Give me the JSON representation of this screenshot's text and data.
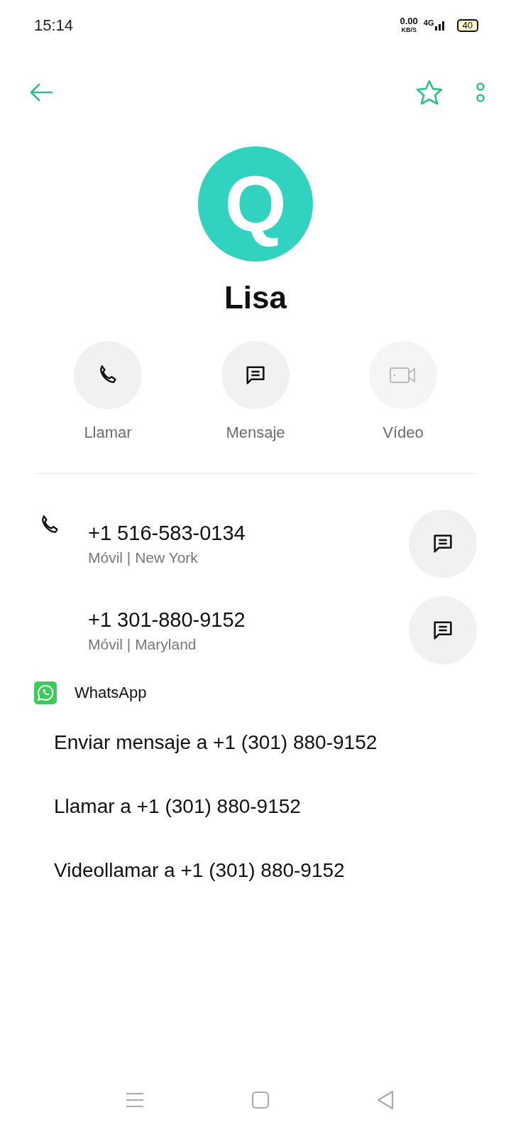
{
  "status_bar": {
    "time": "15:14",
    "speed": "0.00",
    "speed_unit": "KB/S",
    "network": "4G",
    "battery": "40"
  },
  "contact": {
    "name": "Lisa",
    "initial": "Q",
    "favorite": false
  },
  "actions": [
    {
      "kind": "call",
      "label": "Llamar",
      "disabled": false
    },
    {
      "kind": "message",
      "label": "Mensaje",
      "disabled": false
    },
    {
      "kind": "video",
      "label": "Vídeo",
      "disabled": true
    }
  ],
  "phones": [
    {
      "number": "+1 516-583-0134",
      "detail": "Móvil | New York",
      "show_icon": true
    },
    {
      "number": "+1 301-880-9152",
      "detail": "Móvil | Maryland",
      "show_icon": false
    }
  ],
  "whatsapp": {
    "title": "WhatsApp",
    "options": [
      "Enviar mensaje a +1 (301) 880-9152",
      "Llamar a +1 (301) 880-9152",
      "Videollamar a +1 (301) 880-9152"
    ]
  }
}
